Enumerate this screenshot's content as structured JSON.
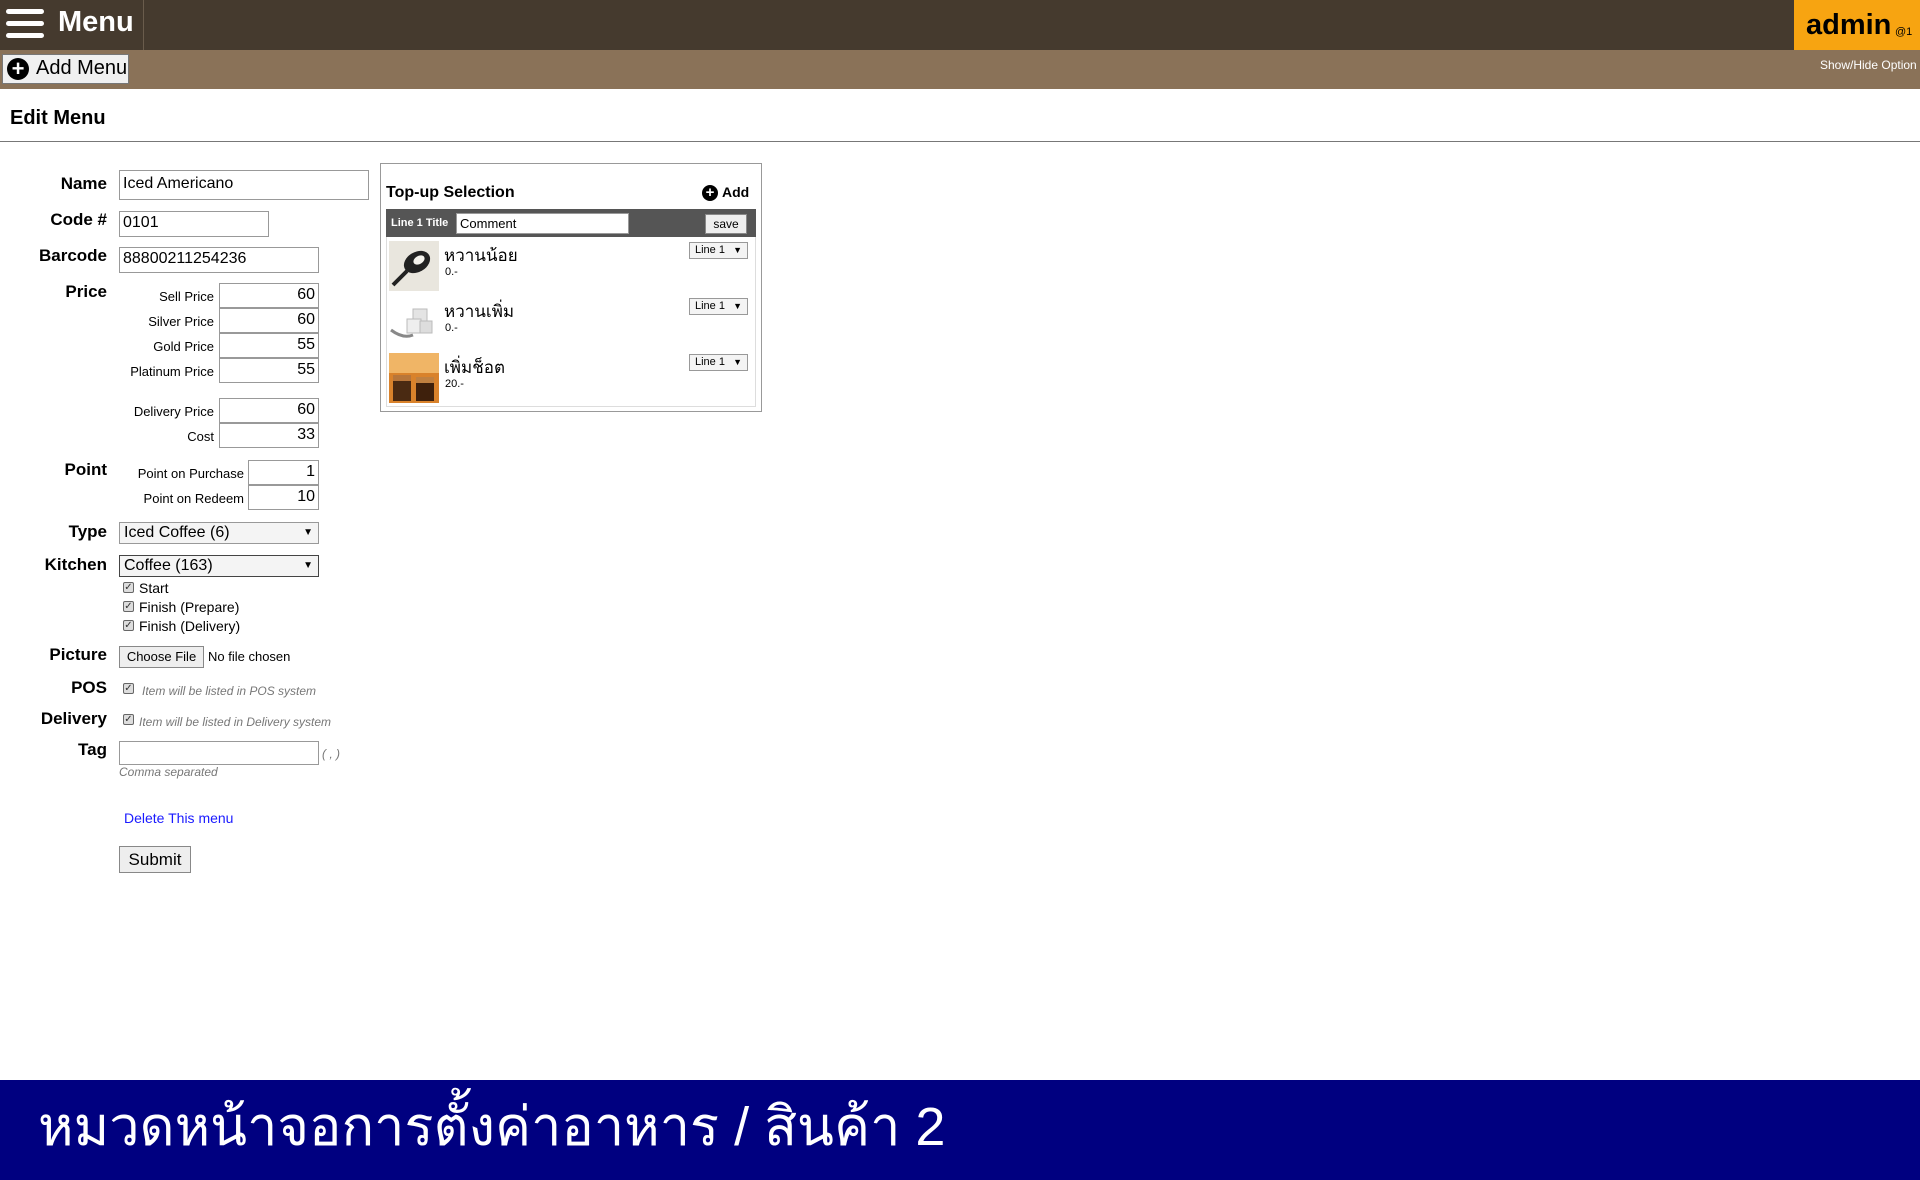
{
  "topbar": {
    "title": "Menu",
    "admin_name": "admin",
    "admin_sub": "@1"
  },
  "subbar": {
    "add_menu_label": "Add Menu",
    "show_hide": "Show/Hide Option"
  },
  "page": {
    "title": "Edit Menu"
  },
  "form": {
    "name_label": "Name",
    "name_value": "Iced Americano",
    "code_label": "Code #",
    "code_value": "0101",
    "barcode_label": "Barcode",
    "barcode_value": "88800211254236",
    "price_label": "Price",
    "prices": [
      {
        "label": "Sell Price",
        "value": "60"
      },
      {
        "label": "Silver Price",
        "value": "60"
      },
      {
        "label": "Gold Price",
        "value": "55"
      },
      {
        "label": "Platinum Price",
        "value": "55"
      }
    ],
    "delivery_price_label": "Delivery Price",
    "delivery_price_value": "60",
    "cost_label": "Cost",
    "cost_value": "33",
    "point_label": "Point",
    "point_purchase_label": "Point on Purchase",
    "point_purchase_value": "1",
    "point_redeem_label": "Point on Redeem",
    "point_redeem_value": "10",
    "type_label": "Type",
    "type_value": "Iced Coffee (6)",
    "kitchen_label": "Kitchen",
    "kitchen_value": "Coffee (163)",
    "kitchen_checks": [
      {
        "label": "Start",
        "checked": true
      },
      {
        "label": "Finish (Prepare)",
        "checked": true
      },
      {
        "label": "Finish (Delivery)",
        "checked": true
      }
    ],
    "picture_label": "Picture",
    "choose_file": "Choose File",
    "no_file": "No file chosen",
    "pos_label": "POS",
    "pos_hint": "Item will be listed in POS system",
    "delivery_label": "Delivery",
    "delivery_hint": "Item will be listed in Delivery system",
    "tag_label": "Tag",
    "tag_value": "",
    "tag_suffix": "( , )",
    "tag_hint": "Comma separated",
    "delete_link": "Delete This menu",
    "submit": "Submit"
  },
  "topup": {
    "title": "Top-up Selection",
    "add_label": "Add",
    "line_title_label": "Line 1 Title",
    "line_title_value": "Comment",
    "save_label": "save",
    "items": [
      {
        "name": "หวานน้อย",
        "price": "0.-",
        "line": "Line 1",
        "icon": "spoon-sugar-icon"
      },
      {
        "name": "หวานเพิ่ม",
        "price": "0.-",
        "line": "Line 1",
        "icon": "sugar-cubes-icon"
      },
      {
        "name": "เพิ่มช็อต",
        "price": "20.-",
        "line": "Line 1",
        "icon": "espresso-shot-icon"
      }
    ]
  },
  "banner": {
    "text": "หมวดหน้าจอการตั้งค่าอาหาร / สินค้า 2"
  },
  "colors": {
    "topbar": "#453a2e",
    "subbar": "#8a7258",
    "admin": "#f7a411",
    "banner": "#000080",
    "link": "#1a1aff"
  }
}
